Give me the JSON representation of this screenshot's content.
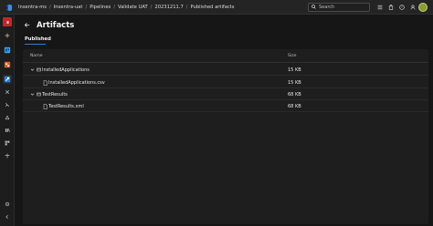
{
  "breadcrumbs": [
    "Insentra-ms",
    "Insentra-uat",
    "Pipelines",
    "Validate UAT",
    "20231211.7",
    "Published artifacts"
  ],
  "search": {
    "placeholder": "Search"
  },
  "page": {
    "title": "Artifacts"
  },
  "tabs": [
    {
      "label": "Published"
    }
  ],
  "table": {
    "headers": {
      "name": "Name",
      "size": "Size"
    },
    "rows": [
      {
        "name": "InstalledApplications",
        "size": "15 KB"
      },
      {
        "name": "InstalledApplications.csv",
        "size": "15 KB"
      },
      {
        "name": "TestResults",
        "size": "68 KB"
      },
      {
        "name": "TestResults.xml",
        "size": "68 KB"
      }
    ]
  },
  "colors": {
    "accent": "#2b7be0",
    "background": "#161616",
    "panel": "#1e1e1e"
  }
}
